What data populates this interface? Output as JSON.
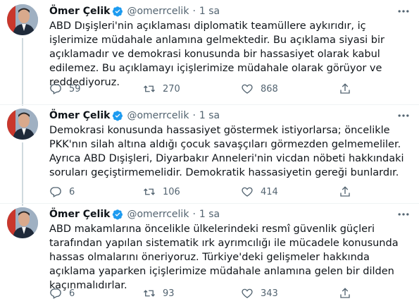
{
  "tweets": [
    {
      "author": {
        "name": "Ömer Çelik",
        "handle": "@omerrcelik",
        "dot": "·",
        "time": "1 sa"
      },
      "text": "ABD Dışişleri'nin açıklaması diplomatik teamüllere aykırıdır,  iç işlerimize müdahale anlamına gelmektedir. Bu açıklama siyasi bir açıklamadır ve demokrasi konusunda bir hassasiyet olarak kabul edilemez. Bu açıklamayı içişlerimize müdahale olarak görüyor ve reddediyoruz.",
      "stats": {
        "replies": "59",
        "retweets": "270",
        "likes": "868"
      }
    },
    {
      "author": {
        "name": "Ömer Çelik",
        "handle": "@omerrcelik",
        "dot": "·",
        "time": "1 sa"
      },
      "text": "Demokrasi konusunda hassasiyet göstermek istiyorlarsa; öncelikle PKK'nın silah altına aldığı çocuk savaşçıları görmezden gelmemeliler. Ayrıca ABD Dışişleri, Diyarbakır Anneleri'nin vicdan nöbeti hakkındaki  soruları geçiştirmemelidir. Demokratik hassasiyetin gereği bunlardır.",
      "stats": {
        "replies": "6",
        "retweets": "106",
        "likes": "414"
      }
    },
    {
      "author": {
        "name": "Ömer Çelik",
        "handle": "@omerrcelik",
        "dot": "·",
        "time": "1 sa"
      },
      "text": "ABD makamlarına öncelikle ülkelerindeki resmî güvenlik güçleri tarafından yapılan sistematik  ırk ayrımcılığı ile mücadele konusunda hassas olmalarını öneriyoruz. Türkiye'deki gelişmeler hakkında açıklama yaparken içişlerimize müdahale anlamına gelen bir dilden kaçınmalıdırlar.",
      "stats": {
        "replies": "6",
        "retweets": "93",
        "likes": "343"
      }
    }
  ],
  "colors": {
    "verified": "#1d9bf0",
    "muted": "#536471",
    "text": "#0f1419",
    "thread_line": "#cfd9de"
  },
  "icons": {
    "verified": "verified-badge-icon",
    "more": "more-options-icon",
    "reply": "reply-icon",
    "retweet": "retweet-icon",
    "like": "heart-icon",
    "share": "share-icon"
  }
}
